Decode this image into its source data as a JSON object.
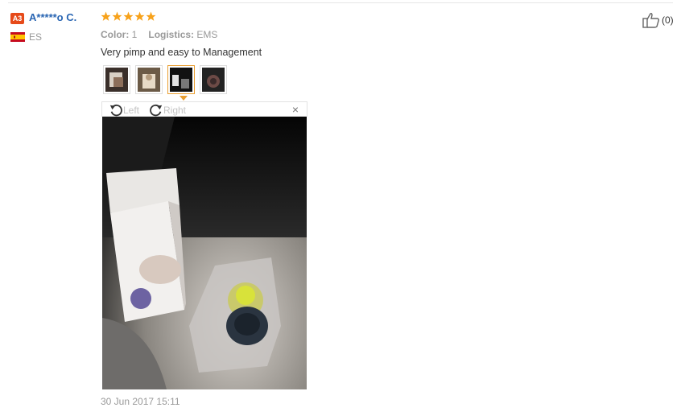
{
  "reviewer": {
    "level_badge": "A3",
    "name": "A*****o C.",
    "country_code": "ES",
    "flag_colors": [
      "#c60b1e",
      "#ffc400"
    ]
  },
  "review": {
    "rating": 5,
    "star_color": "#f7a21b",
    "attributes": [
      {
        "key": "Color:",
        "value": "1"
      },
      {
        "key": "Logistics:",
        "value": "EMS"
      }
    ],
    "text": "Very pimp and easy to Management",
    "thumbnails": [
      {
        "name": "photo-1"
      },
      {
        "name": "photo-2"
      },
      {
        "name": "photo-3",
        "selected": true
      },
      {
        "name": "photo-4"
      }
    ],
    "viewer": {
      "rotate_left_label": "Left",
      "rotate_right_label": "Right",
      "close_label": "×"
    },
    "date": "30 Jun 2017 15:11"
  },
  "helpful": {
    "count_label": "(0)"
  }
}
